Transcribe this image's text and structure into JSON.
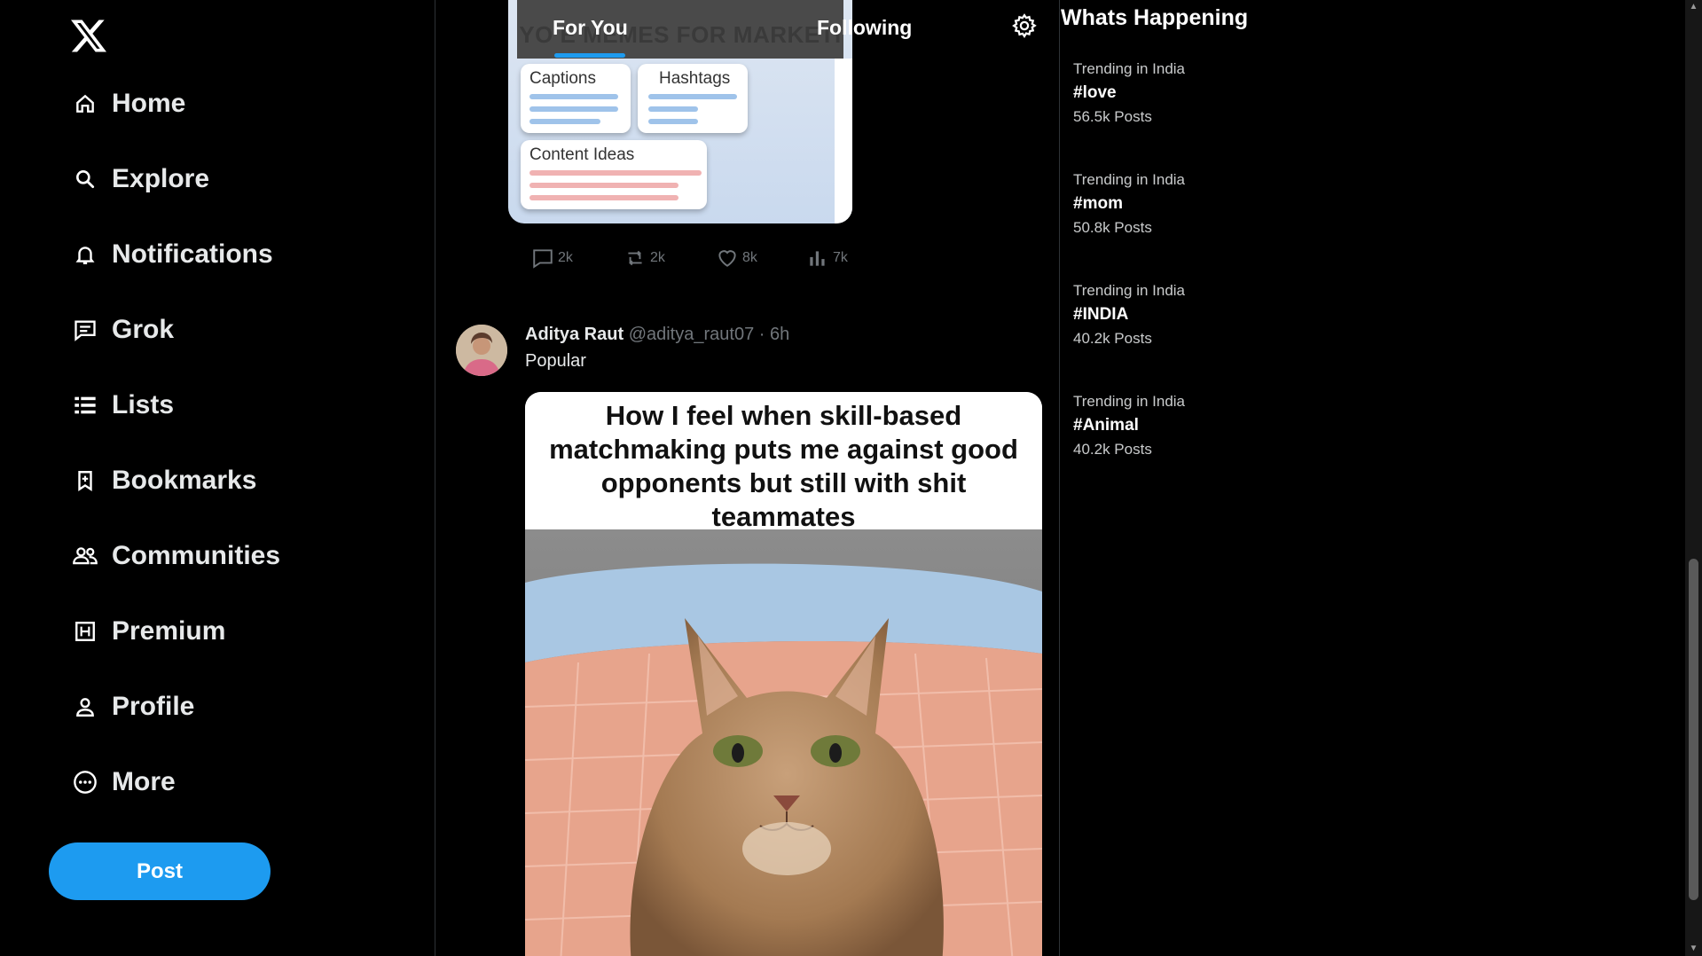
{
  "nav": {
    "items": [
      {
        "label": "Home",
        "icon": "home-icon"
      },
      {
        "label": "Explore",
        "icon": "search-icon"
      },
      {
        "label": "Notifications",
        "icon": "bell-icon"
      },
      {
        "label": "Grok",
        "icon": "grok-icon"
      },
      {
        "label": "Lists",
        "icon": "list-icon"
      },
      {
        "label": "Bookmarks",
        "icon": "bookmark-icon"
      },
      {
        "label": "Communities",
        "icon": "communities-icon"
      },
      {
        "label": "Premium",
        "icon": "premium-icon"
      },
      {
        "label": "Profile",
        "icon": "person-icon"
      },
      {
        "label": "More",
        "icon": "more-icon"
      }
    ],
    "post_label": "Post"
  },
  "tabs": {
    "for_you": "For You",
    "following": "Following",
    "active": "For You"
  },
  "prev_post": {
    "banner_text": "YO    E MEMES FOR MARKETI",
    "cards": [
      "Captions",
      "Hashtags",
      "Content Ideas"
    ],
    "actions": {
      "replies": "2k",
      "reposts": "2k",
      "likes": "8k",
      "views": "7k"
    }
  },
  "post": {
    "author_name": "Aditya Raut",
    "handle": "@aditya_raut07",
    "separator": "·",
    "time": "6h",
    "text": "Popular",
    "meme_caption": "How I feel when skill-based matchmaking puts me against good opponents but still with shit teammates"
  },
  "right": {
    "title": "Whats Happening",
    "trends": [
      {
        "context": "Trending in India",
        "tag": "#love",
        "count": "56.5k Posts"
      },
      {
        "context": "Trending in India",
        "tag": "#mom",
        "count": "50.8k Posts"
      },
      {
        "context": "Trending in India",
        "tag": "#INDIA",
        "count": "40.2k Posts"
      },
      {
        "context": "Trending in India",
        "tag": "#Animal",
        "count": "40.2k Posts"
      }
    ]
  },
  "colors": {
    "accent": "#1d9bf0",
    "background": "#000000",
    "muted_text": "#71767b"
  }
}
